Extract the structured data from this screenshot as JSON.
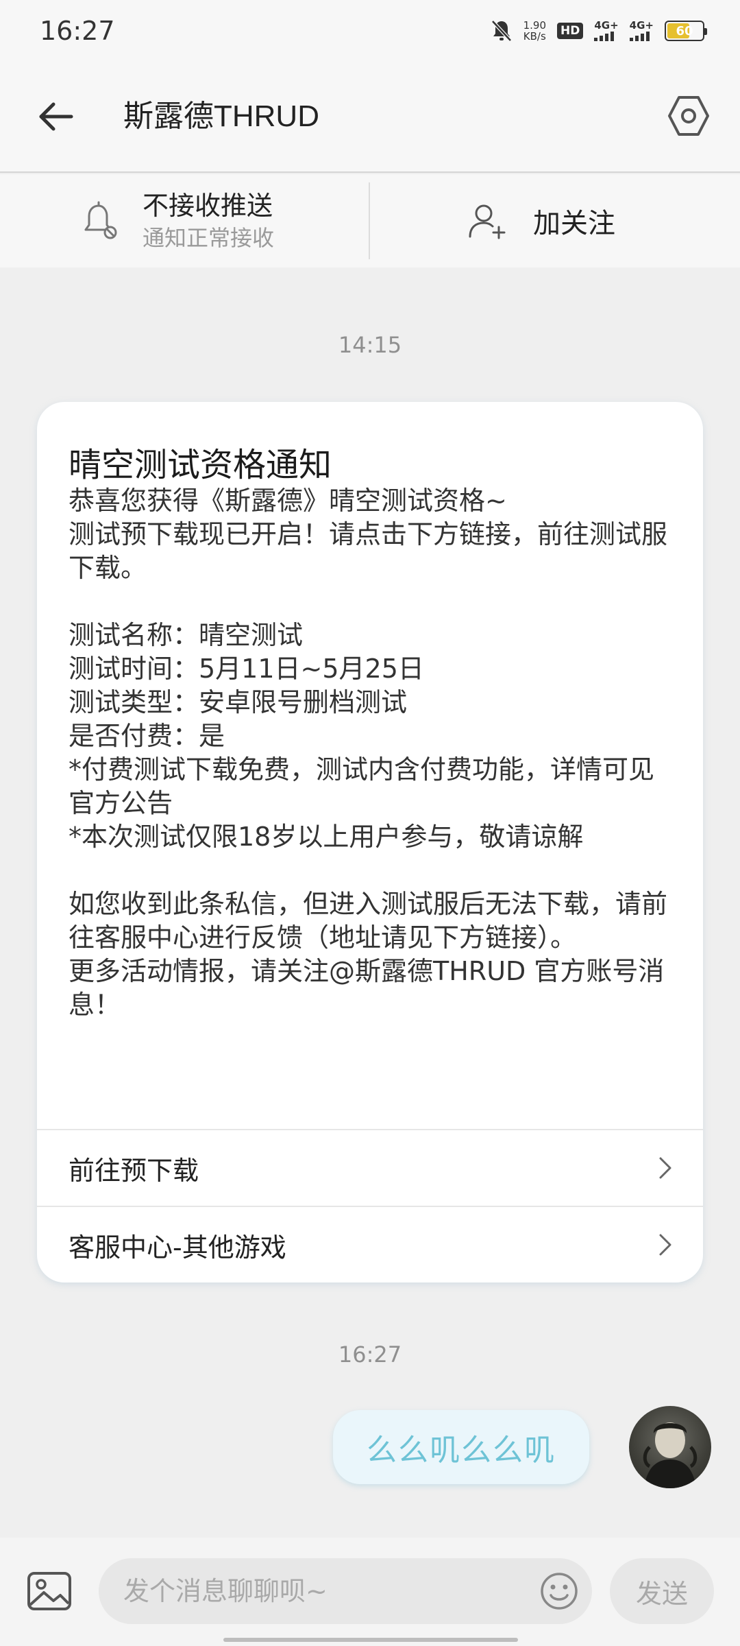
{
  "status_bar": {
    "time": "16:27",
    "net_speed_value": "1.90",
    "net_speed_unit": "KB/s",
    "hd_label": "HD",
    "signal1_label": "4G+",
    "signal2_label": "4G+",
    "battery_level": "60",
    "icons": [
      "mute-bell-icon",
      "hd-icon",
      "signal-icon",
      "signal-icon",
      "battery-icon"
    ]
  },
  "header": {
    "title": "斯露德THRUD",
    "back_icon": "arrow-left-icon",
    "settings_icon": "settings-hex-icon"
  },
  "action_bar": {
    "push_title": "不接收推送",
    "push_subtitle": "通知正常接收",
    "follow_label": "加关注"
  },
  "chat": {
    "timestamp1": "14:15",
    "card": {
      "title": "晴空测试资格通知",
      "lines": [
        "恭喜您获得《斯露德》晴空测试资格~",
        "测试预下载现已开启！请点击下方链接，前往测试服下载。",
        "",
        "测试名称：晴空测试",
        "测试时间：5月11日~5月25日",
        "测试类型：安卓限号删档测试",
        "是否付费：是",
        "*付费测试下载免费，测试内含付费功能，详情可见官方公告",
        "*本次测试仅限18岁以上用户参与，敬请谅解",
        "",
        "如您收到此条私信，但进入测试服后无法下载，请前往客服中心进行反馈（地址请见下方链接）。",
        "更多活动情报，请关注@斯露德THRUD 官方账号消息！"
      ],
      "link1": "前往预下载",
      "link2": "客服中心-其他游戏"
    },
    "timestamp2": "16:27",
    "my_message": "么么叽么么叽"
  },
  "input_bar": {
    "placeholder": "发个消息聊聊呗~",
    "send_label": "发送"
  }
}
